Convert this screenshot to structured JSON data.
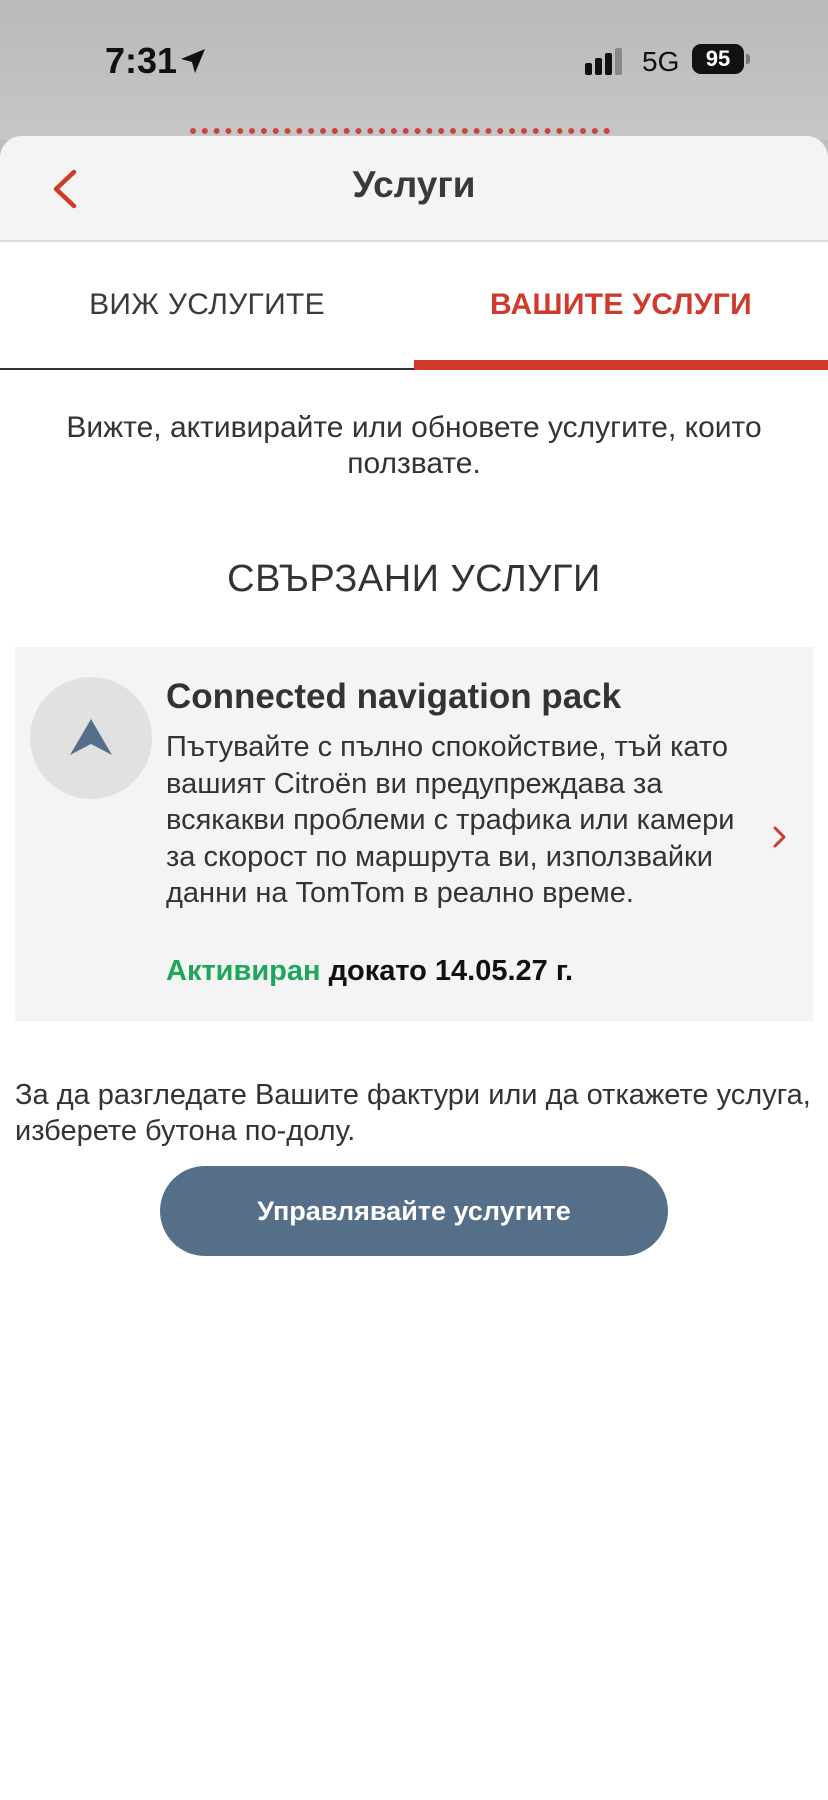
{
  "status_bar": {
    "time": "7:31",
    "network": "5G",
    "battery": "95"
  },
  "header": {
    "title": "Услуги",
    "back_icon": "chevron-left-icon"
  },
  "tabs": [
    {
      "label": "ВИЖ УСЛУГИТЕ",
      "selected": false
    },
    {
      "label": "ВАШИТЕ УСЛУГИ",
      "selected": true
    }
  ],
  "intro_text": "Вижте, активирайте или обновете услугите, които ползвате.",
  "section_title": "СВЪРЗАНИ УСЛУГИ",
  "services": [
    {
      "icon": "navigation-arrow-icon",
      "title": "Connected navigation pack",
      "description": "Пътувайте с пълно спокойствие, тъй като вашият Citroën ви предупреждава за всякакви проблеми с трафика или камери за скорост по маршрута ви, използвайки данни на TomTom в реално време.",
      "status": "Активиран",
      "status_suffix": " докато 14.05.27 г."
    }
  ],
  "info_text": "За да разгледате Вашите фактури или да откажете услуга, изберете бутона по-долу.",
  "manage_button": "Управлявайте услугите",
  "colors": {
    "accent": "#d03a2c",
    "active_status": "#1ea65a",
    "button": "#566f89",
    "card_bg": "#f5f4f4"
  }
}
